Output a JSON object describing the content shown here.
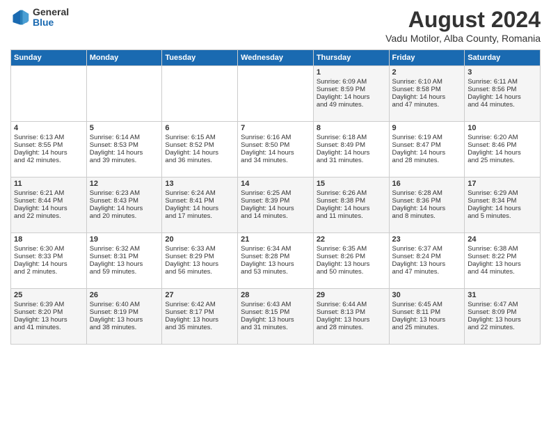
{
  "header": {
    "logo_general": "General",
    "logo_blue": "Blue",
    "main_title": "August 2024",
    "subtitle": "Vadu Motilor, Alba County, Romania"
  },
  "days_of_week": [
    "Sunday",
    "Monday",
    "Tuesday",
    "Wednesday",
    "Thursday",
    "Friday",
    "Saturday"
  ],
  "weeks": [
    [
      {
        "day": "",
        "info": ""
      },
      {
        "day": "",
        "info": ""
      },
      {
        "day": "",
        "info": ""
      },
      {
        "day": "",
        "info": ""
      },
      {
        "day": "1",
        "info": "Sunrise: 6:09 AM\nSunset: 8:59 PM\nDaylight: 14 hours\nand 49 minutes."
      },
      {
        "day": "2",
        "info": "Sunrise: 6:10 AM\nSunset: 8:58 PM\nDaylight: 14 hours\nand 47 minutes."
      },
      {
        "day": "3",
        "info": "Sunrise: 6:11 AM\nSunset: 8:56 PM\nDaylight: 14 hours\nand 44 minutes."
      }
    ],
    [
      {
        "day": "4",
        "info": "Sunrise: 6:13 AM\nSunset: 8:55 PM\nDaylight: 14 hours\nand 42 minutes."
      },
      {
        "day": "5",
        "info": "Sunrise: 6:14 AM\nSunset: 8:53 PM\nDaylight: 14 hours\nand 39 minutes."
      },
      {
        "day": "6",
        "info": "Sunrise: 6:15 AM\nSunset: 8:52 PM\nDaylight: 14 hours\nand 36 minutes."
      },
      {
        "day": "7",
        "info": "Sunrise: 6:16 AM\nSunset: 8:50 PM\nDaylight: 14 hours\nand 34 minutes."
      },
      {
        "day": "8",
        "info": "Sunrise: 6:18 AM\nSunset: 8:49 PM\nDaylight: 14 hours\nand 31 minutes."
      },
      {
        "day": "9",
        "info": "Sunrise: 6:19 AM\nSunset: 8:47 PM\nDaylight: 14 hours\nand 28 minutes."
      },
      {
        "day": "10",
        "info": "Sunrise: 6:20 AM\nSunset: 8:46 PM\nDaylight: 14 hours\nand 25 minutes."
      }
    ],
    [
      {
        "day": "11",
        "info": "Sunrise: 6:21 AM\nSunset: 8:44 PM\nDaylight: 14 hours\nand 22 minutes."
      },
      {
        "day": "12",
        "info": "Sunrise: 6:23 AM\nSunset: 8:43 PM\nDaylight: 14 hours\nand 20 minutes."
      },
      {
        "day": "13",
        "info": "Sunrise: 6:24 AM\nSunset: 8:41 PM\nDaylight: 14 hours\nand 17 minutes."
      },
      {
        "day": "14",
        "info": "Sunrise: 6:25 AM\nSunset: 8:39 PM\nDaylight: 14 hours\nand 14 minutes."
      },
      {
        "day": "15",
        "info": "Sunrise: 6:26 AM\nSunset: 8:38 PM\nDaylight: 14 hours\nand 11 minutes."
      },
      {
        "day": "16",
        "info": "Sunrise: 6:28 AM\nSunset: 8:36 PM\nDaylight: 14 hours\nand 8 minutes."
      },
      {
        "day": "17",
        "info": "Sunrise: 6:29 AM\nSunset: 8:34 PM\nDaylight: 14 hours\nand 5 minutes."
      }
    ],
    [
      {
        "day": "18",
        "info": "Sunrise: 6:30 AM\nSunset: 8:33 PM\nDaylight: 14 hours\nand 2 minutes."
      },
      {
        "day": "19",
        "info": "Sunrise: 6:32 AM\nSunset: 8:31 PM\nDaylight: 13 hours\nand 59 minutes."
      },
      {
        "day": "20",
        "info": "Sunrise: 6:33 AM\nSunset: 8:29 PM\nDaylight: 13 hours\nand 56 minutes."
      },
      {
        "day": "21",
        "info": "Sunrise: 6:34 AM\nSunset: 8:28 PM\nDaylight: 13 hours\nand 53 minutes."
      },
      {
        "day": "22",
        "info": "Sunrise: 6:35 AM\nSunset: 8:26 PM\nDaylight: 13 hours\nand 50 minutes."
      },
      {
        "day": "23",
        "info": "Sunrise: 6:37 AM\nSunset: 8:24 PM\nDaylight: 13 hours\nand 47 minutes."
      },
      {
        "day": "24",
        "info": "Sunrise: 6:38 AM\nSunset: 8:22 PM\nDaylight: 13 hours\nand 44 minutes."
      }
    ],
    [
      {
        "day": "25",
        "info": "Sunrise: 6:39 AM\nSunset: 8:20 PM\nDaylight: 13 hours\nand 41 minutes."
      },
      {
        "day": "26",
        "info": "Sunrise: 6:40 AM\nSunset: 8:19 PM\nDaylight: 13 hours\nand 38 minutes."
      },
      {
        "day": "27",
        "info": "Sunrise: 6:42 AM\nSunset: 8:17 PM\nDaylight: 13 hours\nand 35 minutes."
      },
      {
        "day": "28",
        "info": "Sunrise: 6:43 AM\nSunset: 8:15 PM\nDaylight: 13 hours\nand 31 minutes."
      },
      {
        "day": "29",
        "info": "Sunrise: 6:44 AM\nSunset: 8:13 PM\nDaylight: 13 hours\nand 28 minutes."
      },
      {
        "day": "30",
        "info": "Sunrise: 6:45 AM\nSunset: 8:11 PM\nDaylight: 13 hours\nand 25 minutes."
      },
      {
        "day": "31",
        "info": "Sunrise: 6:47 AM\nSunset: 8:09 PM\nDaylight: 13 hours\nand 22 minutes."
      }
    ]
  ]
}
